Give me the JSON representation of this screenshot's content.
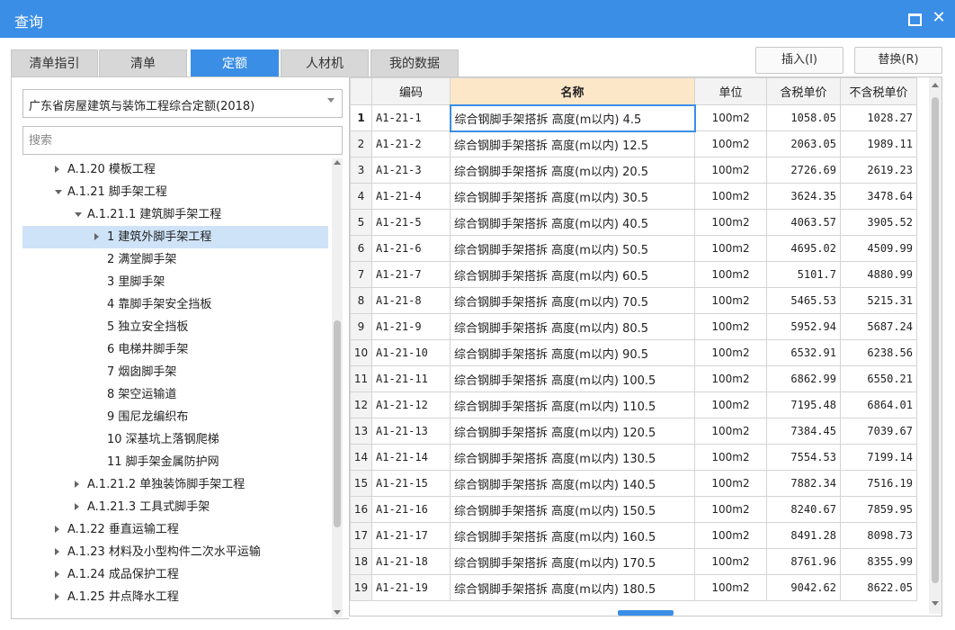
{
  "window": {
    "title": "查询"
  },
  "tabs": [
    {
      "label": "清单指引",
      "active": false
    },
    {
      "label": "清单",
      "active": false
    },
    {
      "label": "定额",
      "active": true
    },
    {
      "label": "人材机",
      "active": false
    },
    {
      "label": "我的数据",
      "active": false
    }
  ],
  "actions": {
    "insert": "插入(I)",
    "replace": "替换(R)"
  },
  "library_select": {
    "value": "广东省房屋建筑与装饰工程综合定额(2018)"
  },
  "search": {
    "placeholder": "搜索"
  },
  "tree": [
    {
      "label": "A.1.20 模板工程",
      "level": 1,
      "state": "collapsed"
    },
    {
      "label": "A.1.21 脚手架工程",
      "level": 1,
      "state": "expanded"
    },
    {
      "label": "A.1.21.1 建筑脚手架工程",
      "level": 2,
      "state": "expanded"
    },
    {
      "label": "1 建筑外脚手架工程",
      "level": 3,
      "state": "collapsed",
      "selected": true
    },
    {
      "label": "2 满堂脚手架",
      "level": 3,
      "state": "leaf"
    },
    {
      "label": "3 里脚手架",
      "level": 3,
      "state": "leaf"
    },
    {
      "label": "4 靠脚手架安全挡板",
      "level": 3,
      "state": "leaf"
    },
    {
      "label": "5 独立安全挡板",
      "level": 3,
      "state": "leaf"
    },
    {
      "label": "6 电梯井脚手架",
      "level": 3,
      "state": "leaf"
    },
    {
      "label": "7 烟囱脚手架",
      "level": 3,
      "state": "leaf"
    },
    {
      "label": "8 架空运输道",
      "level": 3,
      "state": "leaf"
    },
    {
      "label": "9 围尼龙编织布",
      "level": 3,
      "state": "leaf"
    },
    {
      "label": "10 深基坑上落钢爬梯",
      "level": 3,
      "state": "leaf"
    },
    {
      "label": "11 脚手架金属防护网",
      "level": 3,
      "state": "leaf"
    },
    {
      "label": "A.1.21.2 单独装饰脚手架工程",
      "level": 2,
      "state": "collapsed"
    },
    {
      "label": "A.1.21.3 工具式脚手架",
      "level": 2,
      "state": "collapsed"
    },
    {
      "label": "A.1.22 垂直运输工程",
      "level": 1,
      "state": "collapsed"
    },
    {
      "label": "A.1.23 材料及小型构件二次水平运输",
      "level": 1,
      "state": "collapsed"
    },
    {
      "label": "A.1.24 成品保护工程",
      "level": 1,
      "state": "collapsed"
    },
    {
      "label": "A.1.25 井点降水工程",
      "level": 1,
      "state": "collapsed"
    }
  ],
  "grid": {
    "columns": [
      "编码",
      "名称",
      "单位",
      "含税单价",
      "不含税单价"
    ],
    "rows": [
      {
        "no": "1",
        "code": "A1-21-1",
        "name": "综合钢脚手架搭拆 高度(m以内) 4.5",
        "unit": "100m2",
        "price_tax": "1058.05",
        "price_notax": "1028.27"
      },
      {
        "no": "2",
        "code": "A1-21-2",
        "name": "综合钢脚手架搭拆 高度(m以内) 12.5",
        "unit": "100m2",
        "price_tax": "2063.05",
        "price_notax": "1989.11"
      },
      {
        "no": "3",
        "code": "A1-21-3",
        "name": "综合钢脚手架搭拆 高度(m以内) 20.5",
        "unit": "100m2",
        "price_tax": "2726.69",
        "price_notax": "2619.23"
      },
      {
        "no": "4",
        "code": "A1-21-4",
        "name": "综合钢脚手架搭拆 高度(m以内) 30.5",
        "unit": "100m2",
        "price_tax": "3624.35",
        "price_notax": "3478.64"
      },
      {
        "no": "5",
        "code": "A1-21-5",
        "name": "综合钢脚手架搭拆 高度(m以内) 40.5",
        "unit": "100m2",
        "price_tax": "4063.57",
        "price_notax": "3905.52"
      },
      {
        "no": "6",
        "code": "A1-21-6",
        "name": "综合钢脚手架搭拆 高度(m以内) 50.5",
        "unit": "100m2",
        "price_tax": "4695.02",
        "price_notax": "4509.99"
      },
      {
        "no": "7",
        "code": "A1-21-7",
        "name": "综合钢脚手架搭拆 高度(m以内) 60.5",
        "unit": "100m2",
        "price_tax": "5101.7",
        "price_notax": "4880.99"
      },
      {
        "no": "8",
        "code": "A1-21-8",
        "name": "综合钢脚手架搭拆 高度(m以内) 70.5",
        "unit": "100m2",
        "price_tax": "5465.53",
        "price_notax": "5215.31"
      },
      {
        "no": "9",
        "code": "A1-21-9",
        "name": "综合钢脚手架搭拆 高度(m以内) 80.5",
        "unit": "100m2",
        "price_tax": "5952.94",
        "price_notax": "5687.24"
      },
      {
        "no": "10",
        "code": "A1-21-10",
        "name": "综合钢脚手架搭拆 高度(m以内) 90.5",
        "unit": "100m2",
        "price_tax": "6532.91",
        "price_notax": "6238.56"
      },
      {
        "no": "11",
        "code": "A1-21-11",
        "name": "综合钢脚手架搭拆 高度(m以内) 100.5",
        "unit": "100m2",
        "price_tax": "6862.99",
        "price_notax": "6550.21"
      },
      {
        "no": "12",
        "code": "A1-21-12",
        "name": "综合钢脚手架搭拆 高度(m以内) 110.5",
        "unit": "100m2",
        "price_tax": "7195.48",
        "price_notax": "6864.01"
      },
      {
        "no": "13",
        "code": "A1-21-13",
        "name": "综合钢脚手架搭拆 高度(m以内) 120.5",
        "unit": "100m2",
        "price_tax": "7384.45",
        "price_notax": "7039.67"
      },
      {
        "no": "14",
        "code": "A1-21-14",
        "name": "综合钢脚手架搭拆 高度(m以内) 130.5",
        "unit": "100m2",
        "price_tax": "7554.53",
        "price_notax": "7199.14"
      },
      {
        "no": "15",
        "code": "A1-21-15",
        "name": "综合钢脚手架搭拆 高度(m以内) 140.5",
        "unit": "100m2",
        "price_tax": "7882.34",
        "price_notax": "7516.19"
      },
      {
        "no": "16",
        "code": "A1-21-16",
        "name": "综合钢脚手架搭拆 高度(m以内) 150.5",
        "unit": "100m2",
        "price_tax": "8240.67",
        "price_notax": "7859.95"
      },
      {
        "no": "17",
        "code": "A1-21-17",
        "name": "综合钢脚手架搭拆 高度(m以内) 160.5",
        "unit": "100m2",
        "price_tax": "8491.28",
        "price_notax": "8098.73"
      },
      {
        "no": "18",
        "code": "A1-21-18",
        "name": "综合钢脚手架搭拆 高度(m以内) 170.5",
        "unit": "100m2",
        "price_tax": "8761.96",
        "price_notax": "8355.99"
      },
      {
        "no": "19",
        "code": "A1-21-19",
        "name": "综合钢脚手架搭拆 高度(m以内) 180.5",
        "unit": "100m2",
        "price_tax": "9042.62",
        "price_notax": "8622.05"
      }
    ]
  },
  "colors": {
    "accent": "#3a8ee6",
    "selected_row": "#cfe3f8",
    "name_header": "#fde7c9"
  },
  "icons": {
    "maximize": "maximize-icon",
    "close": "close-icon",
    "dropdown": "chevron-down-icon",
    "expand": "triangle-right-icon",
    "collapse": "triangle-down-icon"
  }
}
